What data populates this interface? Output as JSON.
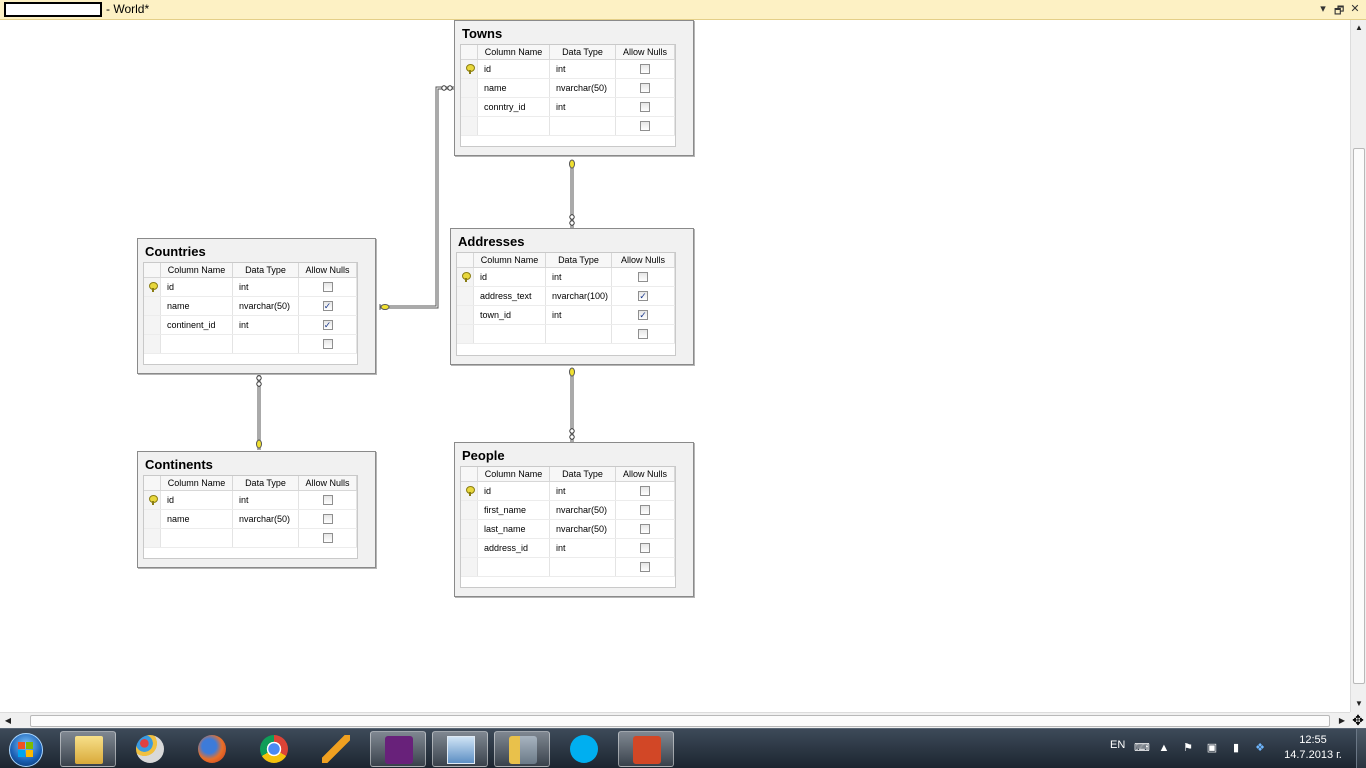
{
  "document": {
    "title": "- World*",
    "window_buttons": {
      "menu": "▾",
      "restore": "🗗",
      "close": "✕"
    }
  },
  "diagram": {
    "headers": {
      "name": "Column Name",
      "type": "Data Type",
      "nulls": "Allow Nulls"
    },
    "tables": {
      "towns": {
        "title": "Towns",
        "rows": [
          {
            "name": "id",
            "type": "int",
            "pk": true,
            "nulls": false
          },
          {
            "name": "name",
            "type": "nvarchar(50)",
            "pk": false,
            "nulls": false
          },
          {
            "name": "conntry_id",
            "type": "int",
            "pk": false,
            "nulls": false
          },
          {
            "name": "",
            "type": "",
            "pk": false,
            "nulls": false
          }
        ]
      },
      "countries": {
        "title": "Countries",
        "rows": [
          {
            "name": "id",
            "type": "int",
            "pk": true,
            "nulls": false
          },
          {
            "name": "name",
            "type": "nvarchar(50)",
            "pk": false,
            "nulls": true
          },
          {
            "name": "continent_id",
            "type": "int",
            "pk": false,
            "nulls": true
          },
          {
            "name": "",
            "type": "",
            "pk": false,
            "nulls": false
          }
        ]
      },
      "addresses": {
        "title": "Addresses",
        "rows": [
          {
            "name": "id",
            "type": "int",
            "pk": true,
            "nulls": false
          },
          {
            "name": "address_text",
            "type": "nvarchar(100)",
            "pk": false,
            "nulls": true
          },
          {
            "name": "town_id",
            "type": "int",
            "pk": false,
            "nulls": true
          },
          {
            "name": "",
            "type": "",
            "pk": false,
            "nulls": false
          }
        ]
      },
      "continents": {
        "title": "Continents",
        "rows": [
          {
            "name": "id",
            "type": "int",
            "pk": true,
            "nulls": false
          },
          {
            "name": "name",
            "type": "nvarchar(50)",
            "pk": false,
            "nulls": false
          },
          {
            "name": "",
            "type": "",
            "pk": false,
            "nulls": false
          }
        ]
      },
      "people": {
        "title": "People",
        "rows": [
          {
            "name": "id",
            "type": "int",
            "pk": true,
            "nulls": false
          },
          {
            "name": "first_name",
            "type": "nvarchar(50)",
            "pk": false,
            "nulls": false
          },
          {
            "name": "last_name",
            "type": "nvarchar(50)",
            "pk": false,
            "nulls": false
          },
          {
            "name": "address_id",
            "type": "int",
            "pk": false,
            "nulls": false
          },
          {
            "name": "",
            "type": "",
            "pk": false,
            "nulls": false
          }
        ]
      }
    },
    "relationships": [
      {
        "from": "countries",
        "to": "towns"
      },
      {
        "from": "towns",
        "to": "addresses"
      },
      {
        "from": "addresses",
        "to": "people"
      },
      {
        "from": "continents",
        "to": "countries"
      }
    ]
  },
  "taskbar": {
    "apps": [
      "windows-explorer",
      "paint",
      "firefox",
      "chrome",
      "winamp",
      "visual-studio",
      "sql-server-management-studio",
      "configuration-tools",
      "skype",
      "powerpoint"
    ],
    "language": "EN",
    "time": "12:55",
    "date": "14.7.2013 г."
  },
  "colors": {
    "key": "#e8d73c",
    "tab_strip": "#fdf1c4",
    "taskbar": "#2a3440"
  }
}
